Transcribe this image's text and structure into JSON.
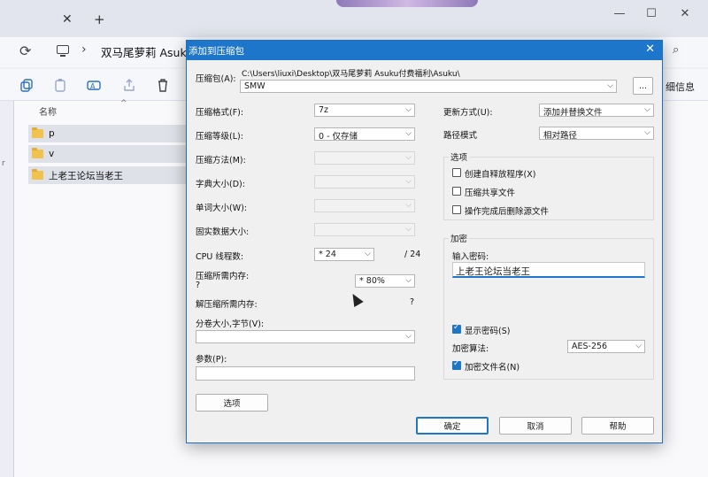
{
  "explorer": {
    "window_title": "双马尾萝莉 Asuku",
    "tab_close": "✕",
    "tab_add": "+",
    "win_min": "—",
    "win_max": "☐",
    "win_close": "✕",
    "address_text": "双马尾萝莉 Asuku",
    "address_sep": "›",
    "details_label": "细信息",
    "column_name": "名称",
    "sort_caret": "^",
    "rows": [
      {
        "label": "p"
      },
      {
        "label": "v"
      },
      {
        "label": "上老王论坛当老王"
      }
    ]
  },
  "dialog": {
    "title": "添加到压缩包",
    "close": "✕",
    "archive_label": "压缩包(A):",
    "archive_path": "C:\\Users\\liuxi\\Desktop\\双马尾萝莉 Asuku付费福利\\Asuku\\",
    "archive_name": "SMW",
    "browse": "...",
    "format_label": "压缩格式(F):",
    "format_value": "7z",
    "level_label": "压缩等级(L):",
    "level_value": "0 - 仅存储",
    "method_label": "压缩方法(M):",
    "dict_label": "字典大小(D):",
    "word_label": "单词大小(W):",
    "solid_label": "固实数据大小:",
    "cpu_label": "CPU 线程数:",
    "cpu_value": "* 24",
    "cpu_max": "/ 24",
    "mem_comp_label": "压缩所需内存:",
    "mem_comp_q": "?",
    "mem_comp_value": "* 80%",
    "mem_decomp_label": "解压缩所需内存:",
    "mem_decomp_q": "?",
    "split_label": "分卷大小,字节(V):",
    "params_label": "参数(P):",
    "options_button": "选项",
    "update_label": "更新方式(U):",
    "update_value": "添加并替换文件",
    "pathmode_label": "路径模式",
    "pathmode_value": "相对路径",
    "options_group": "选项",
    "opt_sfx": "创建自释放程序(X)",
    "opt_shared": "压缩共享文件",
    "opt_delete": "操作完成后删除源文件",
    "encrypt_group": "加密",
    "password_label": "输入密码:",
    "password_value": "上老王论坛当老王",
    "show_password": "显示密码(S)",
    "enc_method_label": "加密算法:",
    "enc_method_value": "AES-256",
    "encrypt_names": "加密文件名(N)",
    "ok": "确定",
    "cancel": "取消",
    "help": "帮助",
    "dropdown_caret": "⌵"
  }
}
